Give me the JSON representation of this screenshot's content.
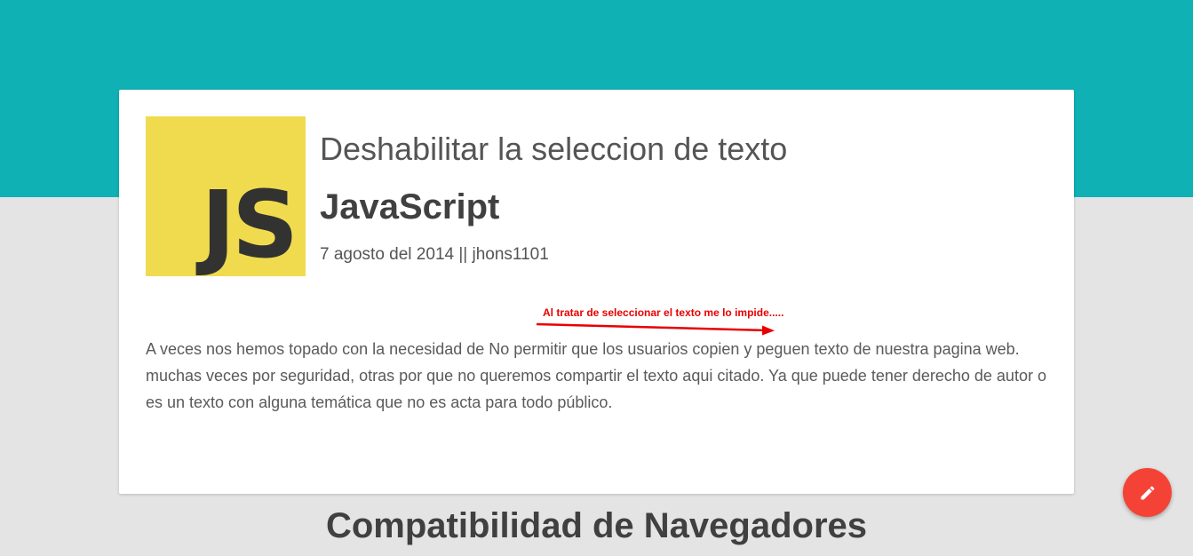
{
  "post": {
    "logo_text": "JS",
    "title": "Deshabilitar la seleccion de texto",
    "category": "JavaScript",
    "meta": "7 agosto del 2014 || jhons1101",
    "annotation": "Al tratar de seleccionar el texto me lo impide.....",
    "paragraphs": [
      "A veces nos hemos topado con la necesidad de No permitir que los usuarios copien y peguen texto de nuestra pagina web.",
      "muchas veces por seguridad, otras por que no queremos compartir el texto aqui citado. Ya que puede tener derecho de autor o es un texto con alguna temática que no es acta para todo público."
    ]
  },
  "section": {
    "heading": "Compatibilidad de Navegadores"
  },
  "fab": {
    "icon": "pencil-icon"
  },
  "colors": {
    "header_band": "#10b1b4",
    "page_background": "#e4e4e4",
    "card": "#ffffff",
    "js_logo": "#f0db4f",
    "annotation": "#e80000",
    "fab": "#f44336"
  }
}
